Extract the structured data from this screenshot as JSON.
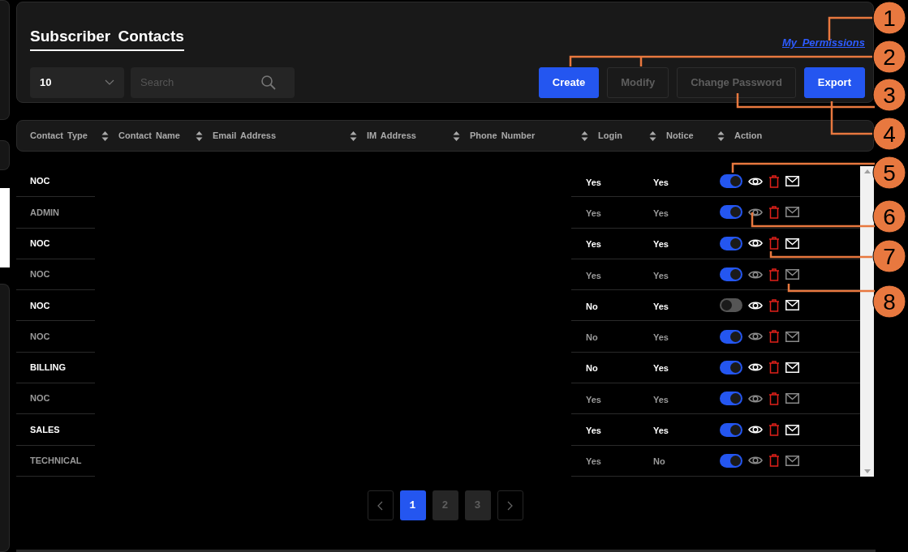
{
  "header": {
    "title": "Subscriber Contacts",
    "permissions_link": "My Permissions",
    "page_size": "10",
    "search": {
      "placeholder": "Search"
    },
    "buttons": [
      {
        "label": "Create",
        "disabled": false
      },
      {
        "label": "Modify",
        "disabled": true
      },
      {
        "label": "Change Password",
        "disabled": true
      },
      {
        "label": "Export",
        "disabled": false
      }
    ]
  },
  "table": {
    "columns": [
      {
        "label": "Contact Type",
        "sortable": true
      },
      {
        "label": "Contact Name",
        "sortable": true
      },
      {
        "label": "Email Address",
        "sortable": true
      },
      {
        "label": "IM Address",
        "sortable": true
      },
      {
        "label": "Phone Number",
        "sortable": true
      },
      {
        "label": "Login",
        "sortable": true
      },
      {
        "label": "Notice",
        "sortable": true
      },
      {
        "label": "Action",
        "sortable": false
      }
    ],
    "rows": [
      {
        "contact_type": "NOC",
        "login": "Yes",
        "notice": "Yes",
        "enabled": true
      },
      {
        "contact_type": "ADMIN",
        "login": "Yes",
        "notice": "Yes",
        "enabled": true
      },
      {
        "contact_type": "NOC",
        "login": "Yes",
        "notice": "Yes",
        "enabled": true
      },
      {
        "contact_type": "NOC",
        "login": "Yes",
        "notice": "Yes",
        "enabled": true
      },
      {
        "contact_type": "NOC",
        "login": "No",
        "notice": "Yes",
        "enabled": false
      },
      {
        "contact_type": "NOC",
        "login": "No",
        "notice": "Yes",
        "enabled": true
      },
      {
        "contact_type": "BILLING",
        "login": "No",
        "notice": "Yes",
        "enabled": true
      },
      {
        "contact_type": "NOC",
        "login": "Yes",
        "notice": "Yes",
        "enabled": true
      },
      {
        "contact_type": "SALES",
        "login": "Yes",
        "notice": "Yes",
        "enabled": true
      },
      {
        "contact_type": "TECHNICAL",
        "login": "Yes",
        "notice": "No",
        "enabled": true
      }
    ]
  },
  "pagination": {
    "pages": [
      {
        "label": "1",
        "selected": true
      },
      {
        "label": "2",
        "selected": false
      },
      {
        "label": "3",
        "selected": false
      }
    ]
  },
  "callouts": [
    {
      "label": "1"
    },
    {
      "label": "2"
    },
    {
      "label": "3"
    },
    {
      "label": "4"
    },
    {
      "label": "5"
    },
    {
      "label": "6"
    },
    {
      "label": "7"
    },
    {
      "label": "8"
    }
  ]
}
